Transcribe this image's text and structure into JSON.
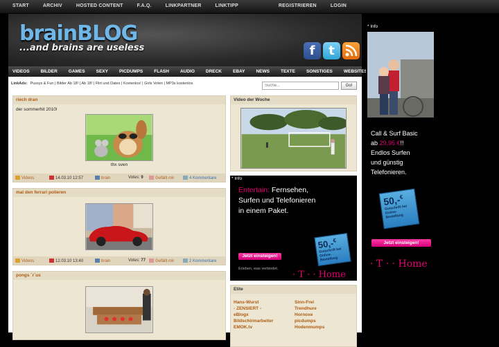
{
  "topnav": {
    "left": [
      "START",
      "ARCHIV",
      "HOSTED CONTENT",
      "F.A.Q.",
      "LINKPARTNER",
      "LINKTIPP"
    ],
    "right": [
      "REGISTRIEREN",
      "LOGIN"
    ]
  },
  "header": {
    "logo_main": "brainBLOG",
    "logo_tagline": "...and brains are useless"
  },
  "mainnav": [
    "VIDEOS",
    "BILDER",
    "GAMES",
    "SEXY",
    "PICDUMPS",
    "FLASH",
    "AUDIO",
    "DRECK",
    "EBAY",
    "NEWS",
    "TEXTE",
    "SONSTIGES",
    "WEBSITES"
  ],
  "linkads": {
    "label": "LinkAds:",
    "text": "Pussys & Fun | Bilder Ab 18! | Ab 18! | Flirt und Dates | Kostenlos! | Girls Voten | MP3s kostenlos"
  },
  "search": {
    "placeholder": "Suche...",
    "button": "Go!"
  },
  "posts": [
    {
      "title": "riech dran",
      "text": "der sommerhit 2010!",
      "caption": "thx sven",
      "category": "Videos",
      "date": "14.03.10 12:57",
      "author": "brain",
      "votes_label": "Votes:",
      "votes": "9",
      "like": "Gefällt mir",
      "comments": "4 Kommentare"
    },
    {
      "title": "mal den ferrari polieren",
      "category": "Videos",
      "date": "12.03.10 13:40",
      "author": "brain",
      "votes_label": "Votes:",
      "votes": "77",
      "like": "Gefällt mir",
      "comments": "2 Kommentare"
    },
    {
      "title": "pongs ´r´us"
    }
  ],
  "sidebar": {
    "video_title": "Video der Woche",
    "ad1": {
      "info": "* Info",
      "line1_mag": "Entertain:",
      "line1_rest": " Fernsehen,",
      "line2": "Surfen und Telefonieren",
      "line3": "in einem Paket.",
      "badge_price": "50,-",
      "badge_cur": "€",
      "badge_small": "Gutschrift bei Online-Bestellung",
      "button": "Jetzt einsteigen!",
      "slogan": "Erleben, was verbindet.",
      "logo": "· T · · Home"
    },
    "elite_title": "Elite",
    "elite_left": [
      "Hans-Wurst",
      "- ZENSIERT -",
      "eBlogx",
      "Bildschirmarbeiter",
      "EMOK.tv"
    ],
    "elite_right": [
      "Sinn-Frei",
      "Trendhure",
      "Hornoxe",
      "picdumps",
      "Hodenmumps"
    ]
  },
  "ad2": {
    "info": "* Info",
    "line1": "Call & Surf Basic",
    "line2_pre": "ab ",
    "line2_price": "29,95 €",
    "line2_post": "!!",
    "line3": "Endlos Surfen",
    "line4": "und günstig",
    "line5": "Telefonieren.",
    "badge_price": "50,-",
    "badge_cur": "€",
    "badge_small": "Gutschrift bei Online-Bestellung",
    "button": "Jetzt einsteigen!",
    "logo": "· T · · Home"
  },
  "colors": {
    "accent_magenta": "#e20074",
    "post_title": "#b05a10",
    "logo_blue": "#6fb7e8"
  }
}
